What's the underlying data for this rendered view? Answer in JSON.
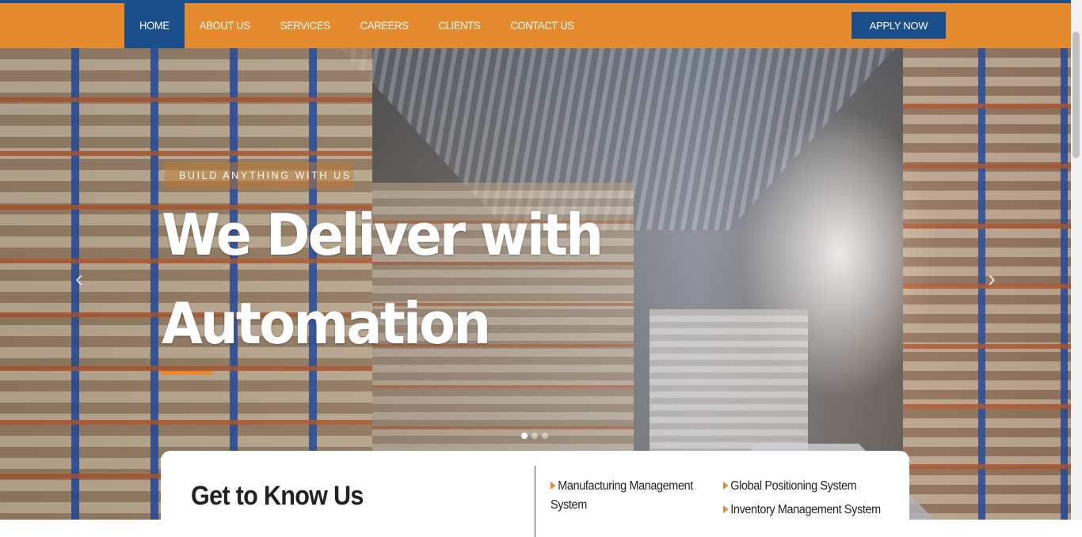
{
  "nav": {
    "items": [
      {
        "label": "HOME",
        "active": true
      },
      {
        "label": "ABOUT US",
        "active": false
      },
      {
        "label": "SERVICES",
        "active": false
      },
      {
        "label": "CAREERS",
        "active": false
      },
      {
        "label": "CLIENTS",
        "active": false
      },
      {
        "label": "CONTACT US",
        "active": false
      }
    ],
    "cta_label": "APPLY NOW"
  },
  "hero": {
    "kicker": "BUILD ANYTHING WITH US",
    "headline_line1": "We Deliver with",
    "headline_line2": "Automation",
    "prev_icon": "chevron-left-icon",
    "next_icon": "chevron-right-icon",
    "slide_count": 3,
    "active_slide": 1
  },
  "about": {
    "title": "Get to Know Us",
    "features": [
      "Manufacturing Management System",
      "Global Positioning System",
      "Inventory Management System"
    ]
  },
  "colors": {
    "brand_orange": "#e68a2e",
    "brand_blue": "#1b4f8c"
  }
}
